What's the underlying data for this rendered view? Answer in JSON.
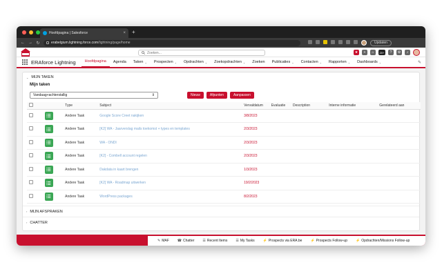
{
  "browser": {
    "tab_title": "Hoofdpagina | Salesforce",
    "tab_close": "×",
    "new_tab": "+",
    "url_domain": "erabelgium.lightning.force.com",
    "url_path": "/lightning/page/home",
    "update_label": "Updaten"
  },
  "header": {
    "search_placeholder": "Zoeken...",
    "badge_count": "20+"
  },
  "appnav": {
    "app_name": "ERAforce Lightning",
    "items": [
      {
        "label": "Hoofdpagina",
        "chevron": false
      },
      {
        "label": "Agenda",
        "chevron": false
      },
      {
        "label": "Taken",
        "chevron": true
      },
      {
        "label": "Prospecten",
        "chevron": true
      },
      {
        "label": "Opdrachten",
        "chevron": true
      },
      {
        "label": "Zoekopdrachten",
        "chevron": true
      },
      {
        "label": "Zoeken",
        "chevron": false
      },
      {
        "label": "Publicaties",
        "chevron": true
      },
      {
        "label": "Contacten",
        "chevron": true
      },
      {
        "label": "Rapporten",
        "chevron": true
      },
      {
        "label": "Dashboards",
        "chevron": true
      }
    ]
  },
  "tasks": {
    "section_title": "MIJN TAKEN",
    "sub_title": "Mijn taken",
    "filter_value": "Vandaag+achterstallig",
    "buttons": {
      "new": "Nieuw",
      "refresh": "Afpunten",
      "edit": "Aanpassen"
    },
    "columns": [
      "Type",
      "Subject",
      "Vervaldatum",
      "Evaluatie",
      "Description",
      "Interne informatie",
      "Gerelateerd aan"
    ],
    "rows": [
      {
        "type": "Andere Taak",
        "subject": "Google Score Creet nakijken",
        "date": "3/8/2023"
      },
      {
        "type": "Andere Taak",
        "subject": "[K2] WA - Jaarverslag mails toekomst + types en templates",
        "date": "2/3/2023"
      },
      {
        "type": "Andere Taak",
        "subject": "WA - ONDI",
        "date": "2/3/2023"
      },
      {
        "type": "Andere Taak",
        "subject": "[K2] - Combell account regelen",
        "date": "2/3/2023"
      },
      {
        "type": "Andere Taak",
        "subject": "Dakdata in kaart brengen",
        "date": "1/3/2023"
      },
      {
        "type": "Andere Taak",
        "subject": "[K2] WA - Roadmap uitwerken",
        "date": "19/2/2023"
      },
      {
        "type": "Andere Taak",
        "subject": "WordPress packages",
        "date": "8/2/2023"
      }
    ]
  },
  "sections": {
    "appointments": "MIJN AFSPRAKEN",
    "chatter": "CHATTER"
  },
  "utility": {
    "items": [
      "MAF",
      "Chatter",
      "Recent Items",
      "My Tasks",
      "Prospects via ERA.be",
      "Prospects Follow-up",
      "Opdrachten/Missions Follow-up"
    ]
  },
  "colors": {
    "brand_red": "#c8102e",
    "task_green": "#3ba755",
    "link_blue": "#0b5cab"
  }
}
